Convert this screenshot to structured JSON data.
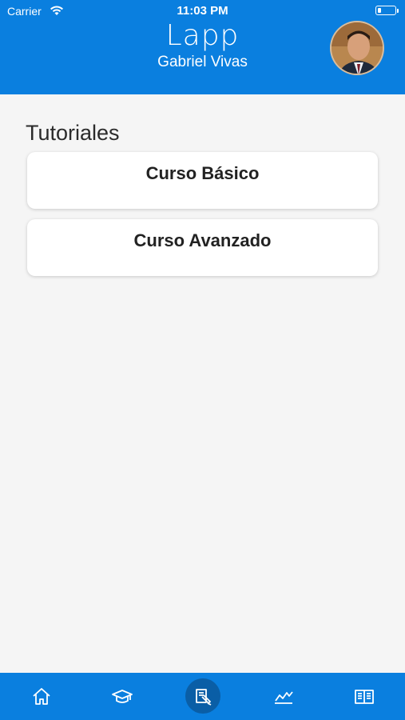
{
  "status_bar": {
    "carrier": "Carrier",
    "time": "11:03 PM"
  },
  "header": {
    "app_title": "Lapp",
    "user_name": "Gabriel Vivas",
    "background_color": "#0a7fdf"
  },
  "main": {
    "section_title": "Tutoriales",
    "courses": [
      {
        "label": "Curso Básico"
      },
      {
        "label": "Curso Avanzado"
      }
    ]
  },
  "tab_bar": {
    "tabs": [
      {
        "icon": "home-icon",
        "active": false
      },
      {
        "icon": "graduation-cap-icon",
        "active": false
      },
      {
        "icon": "tutorial-icon",
        "active": true
      },
      {
        "icon": "chart-icon",
        "active": false
      },
      {
        "icon": "book-icon",
        "active": false
      }
    ],
    "active_color": "#0a5ea6"
  }
}
